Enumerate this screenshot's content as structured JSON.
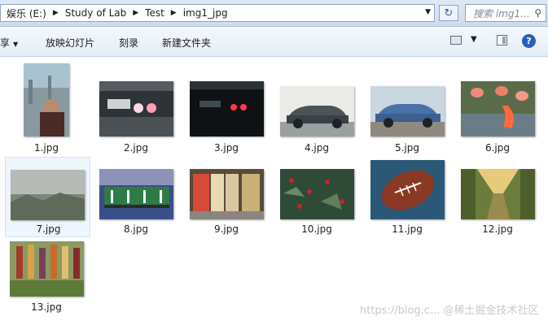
{
  "address": {
    "crumbs": [
      "娱乐 (E:)",
      "Study of Lab",
      "Test",
      "img1_jpg"
    ],
    "sep": "▶",
    "dropdown": "▼"
  },
  "refresh_glyph": "↻",
  "search": {
    "placeholder": "搜索 img1...",
    "icon": "⚲"
  },
  "toolbar": {
    "share": "享",
    "slideshow": "放映幻灯片",
    "burn": "刻录",
    "new_folder": "新建文件夹",
    "view_dropdown": "▼",
    "help": "?"
  },
  "files": [
    {
      "name": "1.jpg",
      "image": "city skyline with child"
    },
    {
      "name": "2.jpg",
      "image": "dark garage with car lights"
    },
    {
      "name": "3.jpg",
      "image": "dark garage with red lights"
    },
    {
      "name": "4.jpg",
      "image": "vintage grey car"
    },
    {
      "name": "5.jpg",
      "image": "vintage blue car"
    },
    {
      "name": "6.jpg",
      "image": "flamingos"
    },
    {
      "name": "7.jpg",
      "image": "hazy city view"
    },
    {
      "name": "8.jpg",
      "image": "foosball table"
    },
    {
      "name": "9.jpg",
      "image": "store vending fridges"
    },
    {
      "name": "10.jpg",
      "image": "holly with red berries"
    },
    {
      "name": "11.jpg",
      "image": "american football"
    },
    {
      "name": "12.jpg",
      "image": "yellow corridor"
    },
    {
      "name": "13.jpg",
      "image": "hanging corn"
    }
  ],
  "selected_file": "7.jpg",
  "watermark": "https://blog.c... @稀土掘金技术社区"
}
